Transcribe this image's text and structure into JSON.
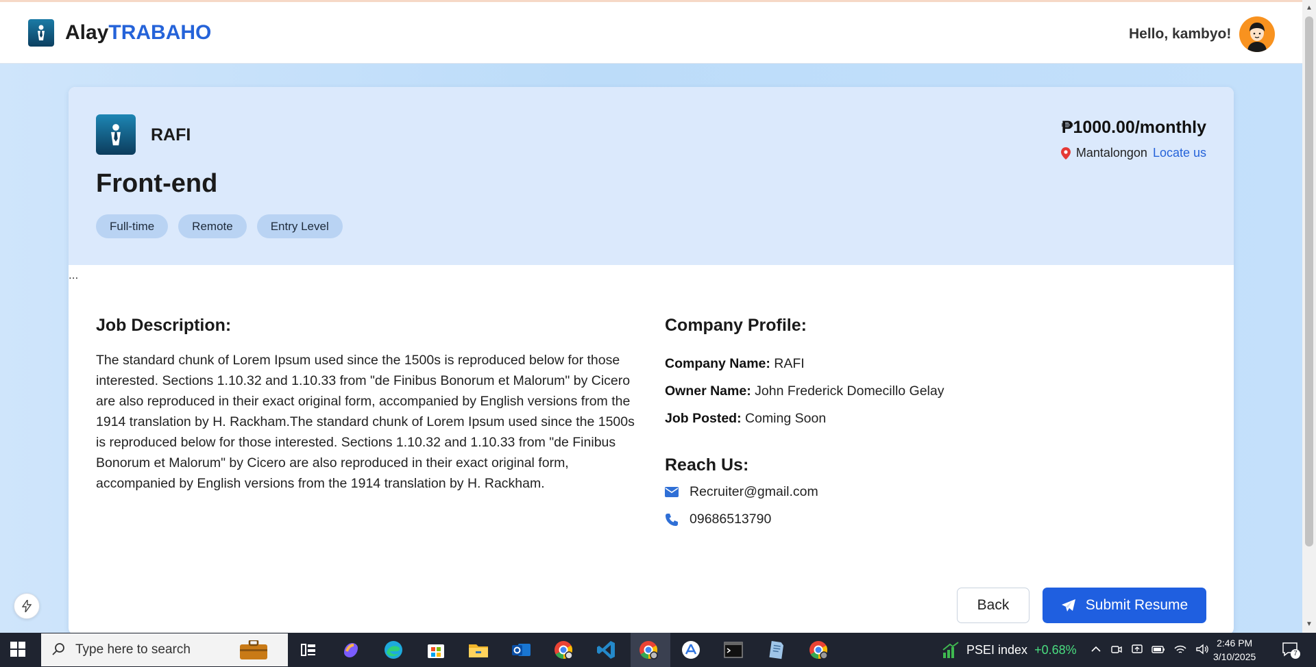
{
  "header": {
    "brand_prefix": "Alay",
    "brand_suffix": "TRABAHO",
    "greeting": "Hello, kambyo!"
  },
  "job": {
    "company": "RAFI",
    "title": "Front-end",
    "tags": [
      "Full-time",
      "Remote",
      "Entry Level"
    ],
    "salary": "₱1000.00/monthly",
    "location": "Mantalongon",
    "locate_link": "Locate us",
    "ellipsis": "...",
    "description_heading": "Job Description:",
    "description": "The standard chunk of Lorem Ipsum used since the 1500s is reproduced below for those interested. Sections 1.10.32 and 1.10.33 from \"de Finibus Bonorum et Malorum\" by Cicero are also reproduced in their exact original form, accompanied by English versions from the 1914 translation by H. Rackham.The standard chunk of Lorem Ipsum used since the 1500s is reproduced below for those interested. Sections 1.10.32 and 1.10.33 from \"de Finibus Bonorum et Malorum\" by Cicero are also reproduced in their exact original form, accompanied by English versions from the 1914 translation by H. Rackham."
  },
  "profile": {
    "heading": "Company Profile:",
    "company_label": "Company Name:",
    "company_value": "RAFI",
    "owner_label": "Owner Name:",
    "owner_value": "John Frederick Domecillo Gelay",
    "posted_label": "Job Posted:",
    "posted_value": "Coming Soon"
  },
  "reach": {
    "heading": "Reach Us:",
    "email": "Recruiter@gmail.com",
    "phone": "09686513790"
  },
  "actions": {
    "back": "Back",
    "submit": "Submit Resume"
  },
  "taskbar": {
    "search_placeholder": "Type here to search",
    "ticker_name": "PSEI index",
    "ticker_change": "+0.68%",
    "time": "2:46 PM",
    "date": "3/10/2025",
    "notification_count": "7"
  },
  "colors": {
    "brand_blue": "#2563d9",
    "button_blue": "#1f5fe0",
    "header_tint": "#dbe9fc",
    "tag_bg": "#b9d3f3",
    "pin_red": "#e53935"
  }
}
